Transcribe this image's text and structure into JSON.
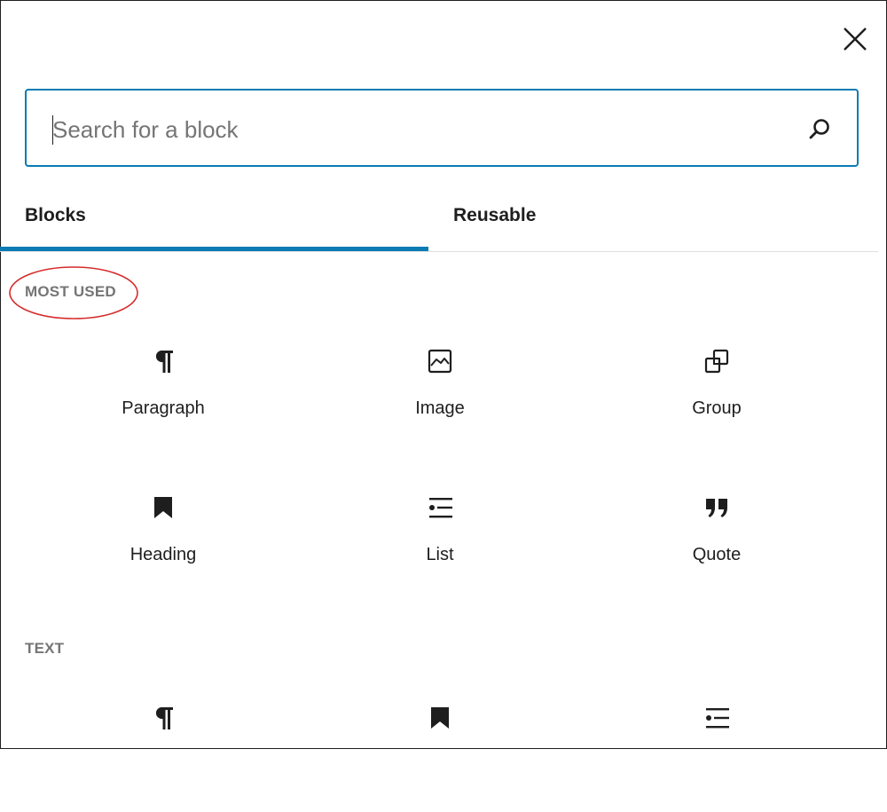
{
  "dialog": {
    "close_label": "Close",
    "search": {
      "placeholder": "Search for a block",
      "value": ""
    },
    "tabs": [
      {
        "label": "Blocks",
        "selected": true
      },
      {
        "label": "Reusable",
        "selected": false
      }
    ],
    "sections": [
      {
        "title": "MOST USED",
        "highlighted": true,
        "items": [
          {
            "label": "Paragraph",
            "icon": "paragraph-icon"
          },
          {
            "label": "Image",
            "icon": "image-icon"
          },
          {
            "label": "Group",
            "icon": "group-icon"
          },
          {
            "label": "Heading",
            "icon": "heading-icon"
          },
          {
            "label": "List",
            "icon": "list-icon"
          },
          {
            "label": "Quote",
            "icon": "quote-icon"
          }
        ]
      },
      {
        "title": "TEXT",
        "items": [
          {
            "label": "",
            "icon": "paragraph-icon"
          },
          {
            "label": "",
            "icon": "heading-icon"
          },
          {
            "label": "",
            "icon": "list-icon"
          }
        ]
      }
    ],
    "colors": {
      "accent": "#0a7bb3",
      "annotation": "#d62b2b",
      "text": "#1e1e1e",
      "muted": "#757575"
    }
  }
}
